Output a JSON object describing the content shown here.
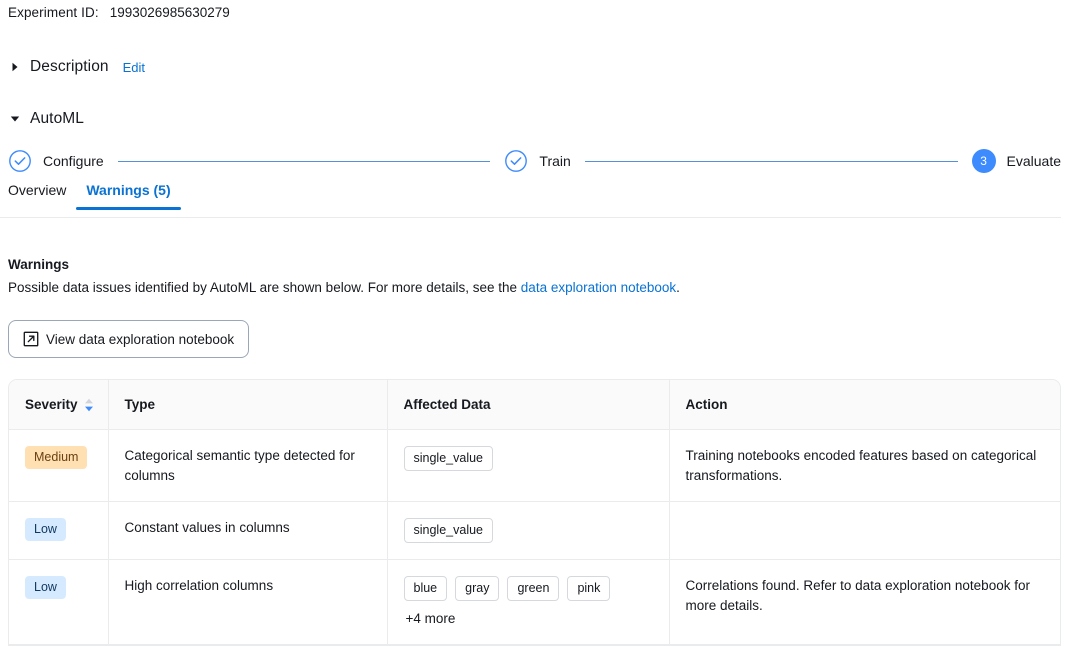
{
  "experiment": {
    "id_label": "Experiment ID:",
    "id_value": "1993026985630279"
  },
  "sections": {
    "description": {
      "title": "Description",
      "edit_label": "Edit",
      "expanded": false,
      "caret_icon": "caret-right-icon"
    },
    "automl": {
      "title": "AutoML",
      "expanded": true,
      "caret_icon": "caret-down-icon"
    }
  },
  "stepper": {
    "steps": [
      {
        "label": "Configure",
        "state": "complete",
        "icon": "check-circle-icon",
        "number": "1"
      },
      {
        "label": "Train",
        "state": "complete",
        "icon": "check-circle-icon",
        "number": "2"
      },
      {
        "label": "Evaluate",
        "state": "current",
        "icon": "number-circle-icon",
        "number": "3"
      }
    ]
  },
  "tabs": [
    {
      "label": "Overview",
      "active": false
    },
    {
      "label": "Warnings (5)",
      "active": true
    }
  ],
  "warnings": {
    "heading": "Warnings",
    "description_prefix": "Possible data issues identified by AutoML are shown below. For more details, see the ",
    "description_link": "data exploration notebook",
    "description_suffix": ".",
    "button_label": "View data exploration notebook",
    "button_icon": "external-link-icon"
  },
  "table": {
    "columns": [
      {
        "label": "Severity",
        "sortable": true,
        "sort_direction": "desc"
      },
      {
        "label": "Type",
        "sortable": false
      },
      {
        "label": "Affected Data",
        "sortable": false
      },
      {
        "label": "Action",
        "sortable": false
      }
    ],
    "rows": [
      {
        "severity": "Medium",
        "severity_level": "medium",
        "type": "Categorical semantic type detected for columns",
        "affected_data": [
          "single_value"
        ],
        "more_count": "",
        "action": "Training notebooks encoded features based on categorical transformations."
      },
      {
        "severity": "Low",
        "severity_level": "low",
        "type": "Constant values in columns",
        "affected_data": [
          "single_value"
        ],
        "more_count": "",
        "action": ""
      },
      {
        "severity": "Low",
        "severity_level": "low",
        "type": "High correlation columns",
        "affected_data": [
          "blue",
          "gray",
          "green",
          "pink"
        ],
        "more_count": "+4 more",
        "action": "Correlations found. Refer to data exploration notebook for more details."
      }
    ]
  },
  "colors": {
    "accent_blue": "#0972d3",
    "step_blue": "#3d8bfd",
    "badge_medium_bg": "#ffe0b3",
    "badge_medium_fg": "#6b4111",
    "badge_low_bg": "#d6eaff",
    "badge_low_fg": "#10375f",
    "border": "#e9ebed"
  }
}
